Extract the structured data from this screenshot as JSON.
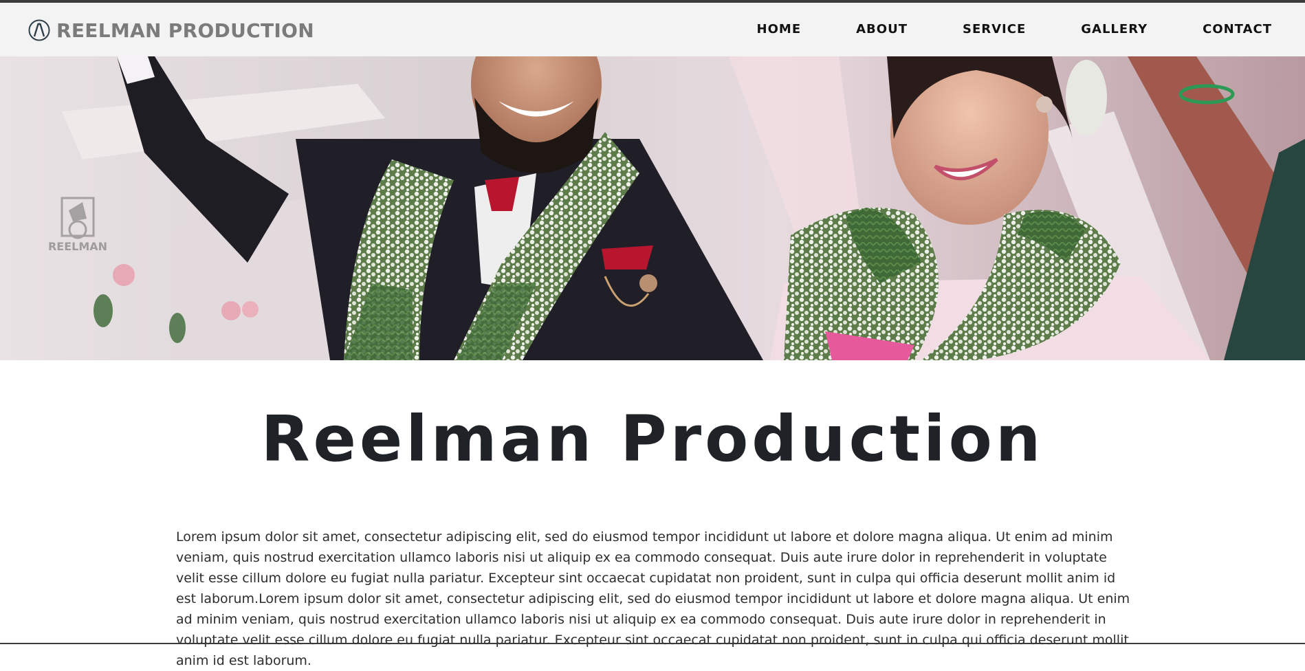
{
  "brand": {
    "name": "REELMAN PRODUCTION",
    "icon": "acura-style-logo-icon"
  },
  "nav": {
    "items": [
      {
        "label": "HOME"
      },
      {
        "label": "ABOUT"
      },
      {
        "label": "SERVICE"
      },
      {
        "label": "GALLERY"
      },
      {
        "label": "CONTACT"
      }
    ]
  },
  "hero": {
    "watermark_text": "REELMAN"
  },
  "main": {
    "heading": "Reelman Production",
    "paragraph": "Lorem ipsum dolor sit amet, consectetur adipiscing elit, sed do eiusmod tempor incididunt ut labore et dolore magna aliqua. Ut enim ad minim veniam, quis nostrud exercitation ullamco laboris nisi ut aliquip ex ea commodo consequat. Duis aute irure dolor in reprehenderit in voluptate velit esse cillum dolore eu fugiat nulla pariatur. Excepteur sint occaecat cupidatat non proident, sunt in culpa qui officia deserunt mollit anim id est laborum.Lorem ipsum dolor sit amet, consectetur adipiscing elit, sed do eiusmod tempor incididunt ut labore et dolore magna aliqua. Ut enim ad minim veniam, quis nostrud exercitation ullamco laboris nisi ut aliquip ex ea commodo consequat. Duis aute irure dolor in reprehenderit in voluptate velit esse cillum dolore eu fugiat nulla pariatur. Excepteur sint occaecat cupidatat non proident, sunt in culpa qui officia deserunt mollit anim id est laborum."
  },
  "colors": {
    "navbar_bg": "#f3f3f3",
    "brand_text": "#7b7b7b",
    "heading": "#1f2227",
    "body_text": "#2d2d2d"
  }
}
